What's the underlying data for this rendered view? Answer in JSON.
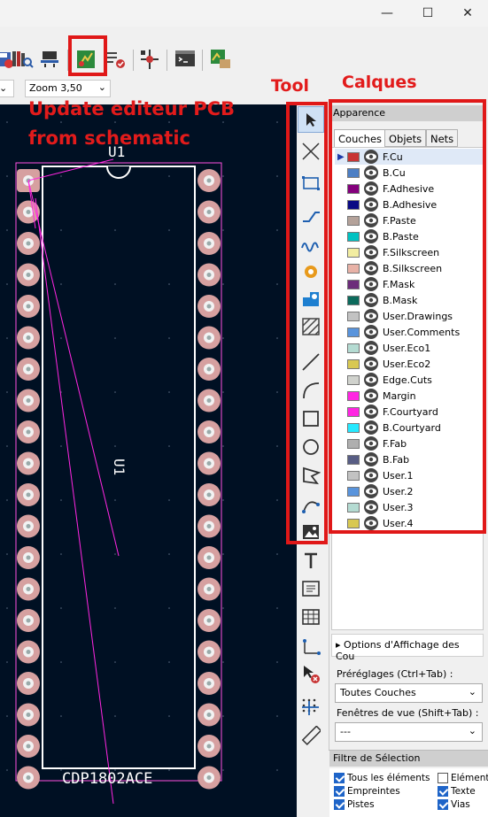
{
  "window": {
    "minimize": "—",
    "maximize": "☐",
    "close": "✕"
  },
  "toolbar": {
    "zoom_value": "Zoom 3,50",
    "icons": [
      "save-icon",
      "library-icon",
      "footprint-editor-icon",
      "update-pcb-icon",
      "checklist-icon",
      "netlist-icon",
      "scripting-console-icon",
      "plugin-icon"
    ]
  },
  "annotations": {
    "tool": "Tool",
    "calques": "Calques",
    "update_line1": "Update editeur PCB",
    "update_line2": "from schematic"
  },
  "pcb": {
    "ref_top": "U1",
    "ref_side": "U1",
    "value": "CDP1802ACE"
  },
  "panel": {
    "title": "Apparence",
    "tabs": [
      "Couches",
      "Objets",
      "Nets"
    ],
    "layers": [
      {
        "name": "F.Cu",
        "color": "#c83434",
        "active": true
      },
      {
        "name": "B.Cu",
        "color": "#4d7fc4",
        "active": false
      },
      {
        "name": "F.Adhesive",
        "color": "#84007c",
        "active": false
      },
      {
        "name": "B.Adhesive",
        "color": "#0a0a84",
        "active": false
      },
      {
        "name": "F.Paste",
        "color": "#b4a29a",
        "active": false
      },
      {
        "name": "B.Paste",
        "color": "#00c2c2",
        "active": false
      },
      {
        "name": "F.Silkscreen",
        "color": "#f2eda1",
        "active": false
      },
      {
        "name": "B.Silkscreen",
        "color": "#e8b2a7",
        "active": false
      },
      {
        "name": "F.Mask",
        "color": "#6c2c7a",
        "active": false
      },
      {
        "name": "B.Mask",
        "color": "#0c6a5c",
        "active": false
      },
      {
        "name": "User.Drawings",
        "color": "#c2c2c2",
        "active": false
      },
      {
        "name": "User.Comments",
        "color": "#5994dc",
        "active": false
      },
      {
        "name": "User.Eco1",
        "color": "#b4dbd2",
        "active": false
      },
      {
        "name": "User.Eco2",
        "color": "#d8c852",
        "active": false
      },
      {
        "name": "Edge.Cuts",
        "color": "#d0d2cd",
        "active": false
      },
      {
        "name": "Margin",
        "color": "#ff26e2",
        "active": false
      },
      {
        "name": "F.Courtyard",
        "color": "#ff26e2",
        "active": false
      },
      {
        "name": "B.Courtyard",
        "color": "#26e9ff",
        "active": false
      },
      {
        "name": "F.Fab",
        "color": "#afafaf",
        "active": false
      },
      {
        "name": "B.Fab",
        "color": "#585d84",
        "active": false
      },
      {
        "name": "User.1",
        "color": "#c2c2c2",
        "active": false
      },
      {
        "name": "User.2",
        "color": "#5994dc",
        "active": false
      },
      {
        "name": "User.3",
        "color": "#b4dbd2",
        "active": false
      },
      {
        "name": "User.4",
        "color": "#d8c852",
        "active": false
      }
    ],
    "display_options": "Options d'Affichage des Cou",
    "presets_label": "Préréglages (Ctrl+Tab) :",
    "presets_value": "Toutes Couches",
    "viewports_label": "Fenêtres de vue (Shift+Tab) :",
    "viewports_value": "---"
  },
  "selection_filter": {
    "title": "Filtre de Sélection",
    "items": [
      {
        "label": "Tous les éléments",
        "checked": true
      },
      {
        "label": "Elément",
        "checked": false
      },
      {
        "label": "Empreintes",
        "checked": true
      },
      {
        "label": "Texte",
        "checked": true
      },
      {
        "label": "Pistes",
        "checked": true
      },
      {
        "label": "Vias",
        "checked": true
      }
    ]
  },
  "colors": {
    "accent_red": "#e21b1b",
    "canvas": "#001023",
    "pad": "#d6a0a0",
    "silk": "#ffffff",
    "ratsnest": "#ff26e2"
  }
}
